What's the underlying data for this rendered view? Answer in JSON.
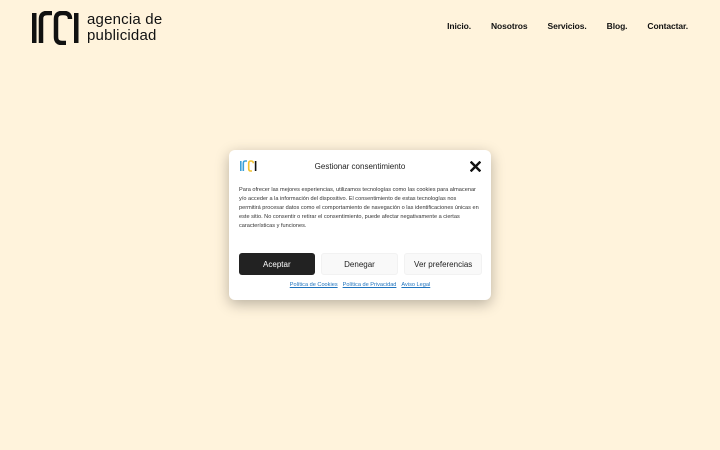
{
  "header": {
    "logo_line1": "agencia de",
    "logo_line2": "publicidad",
    "nav": [
      "Inicio.",
      "Nosotros",
      "Servicios.",
      "Blog.",
      "Contactar."
    ]
  },
  "consent": {
    "title": "Gestionar consentimiento",
    "body": "Para ofrecer las mejores experiencias, utilizamos tecnologías como las cookies para almacenar y/o acceder a la información del dispositivo. El consentimiento de estas tecnologías nos permitirá procesar datos como el comportamiento de navegación o las identificaciones únicas en este sitio. No consentir o retirar el consentimiento, puede afectar negativamente a ciertas características y funciones.",
    "accept_label": "Aceptar",
    "deny_label": "Denegar",
    "prefs_label": "Ver preferencias",
    "links": [
      "Política de Cookies",
      "Política de Privacidad",
      "Aviso Legal"
    ]
  },
  "colors": {
    "background": "#fff3dc",
    "accept_button": "#222222",
    "link": "#1e73be",
    "logo_blue": "#3aa0d8",
    "logo_yellow": "#f2c230"
  },
  "icons": {
    "close": "close-x-icon",
    "logo": "brand-logo-icon"
  }
}
